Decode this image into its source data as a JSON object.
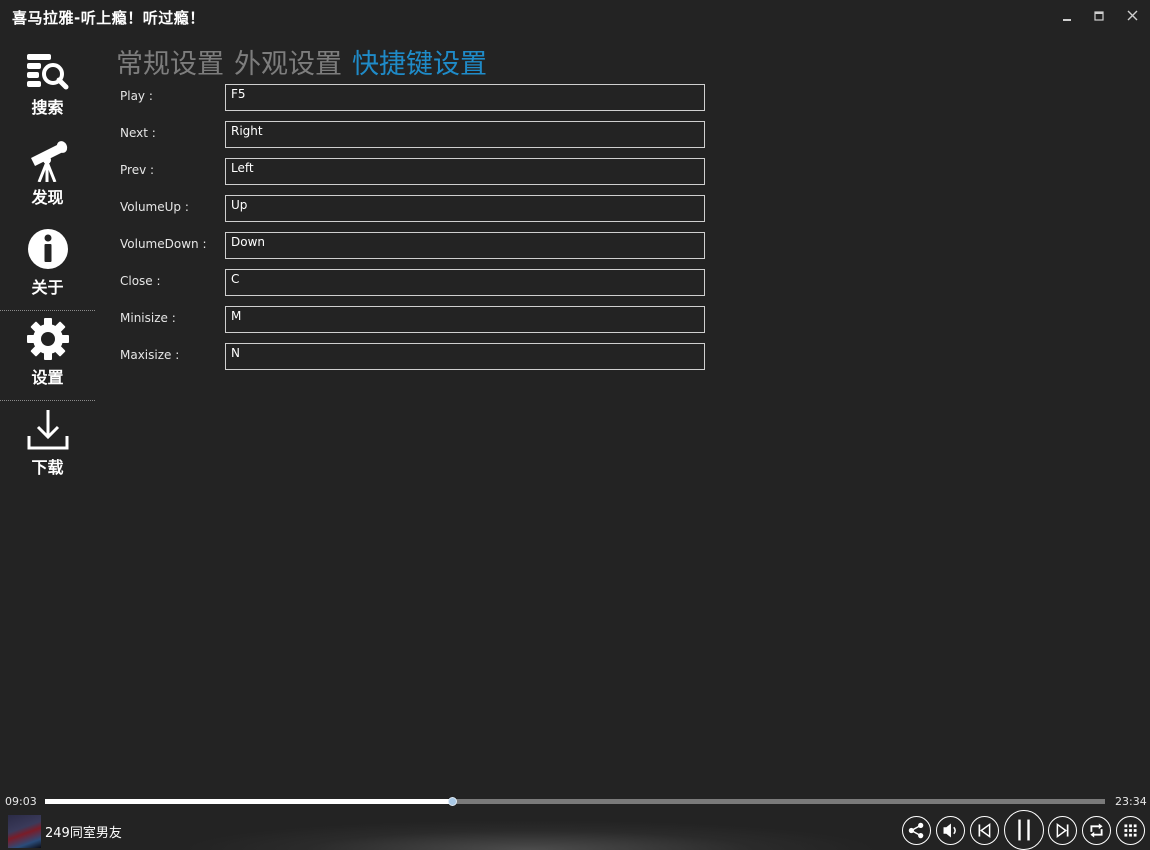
{
  "window": {
    "title": "喜马拉雅-听上瘾！听过瘾！",
    "minimize": "−",
    "maximize": "□",
    "close": "✕"
  },
  "sidebar": {
    "items": [
      {
        "label": "搜索",
        "icon": "search-icon"
      },
      {
        "label": "发现",
        "icon": "telescope-icon"
      },
      {
        "label": "关于",
        "icon": "info-icon"
      },
      {
        "label": "设置",
        "icon": "gear-icon"
      },
      {
        "label": "下载",
        "icon": "download-icon"
      }
    ]
  },
  "tabs": [
    {
      "label": "常规设置",
      "active": false
    },
    {
      "label": "外观设置",
      "active": false
    },
    {
      "label": "快捷键设置",
      "active": true
    }
  ],
  "shortcuts": [
    {
      "label": "Play :",
      "value": "F5"
    },
    {
      "label": "Next :",
      "value": "Right"
    },
    {
      "label": "Prev :",
      "value": "Left"
    },
    {
      "label": "VolumeUp :",
      "value": "Up"
    },
    {
      "label": "VolumeDown :",
      "value": "Down"
    },
    {
      "label": "Close :",
      "value": "C"
    },
    {
      "label": "Minisize :",
      "value": "M"
    },
    {
      "label": "Maxisize :",
      "value": "N"
    }
  ],
  "player": {
    "current_time": "09:03",
    "total_time": "23:34",
    "progress": 0.384,
    "track_title": "249同室男友",
    "controls": [
      "share-icon",
      "volume-icon",
      "previous-icon",
      "pause-icon",
      "next-icon",
      "repeat-icon",
      "playlist-icon"
    ]
  },
  "colors": {
    "background": "#232323",
    "accent": "#1f8bc8",
    "inactive_tab": "#7d7d7d"
  }
}
